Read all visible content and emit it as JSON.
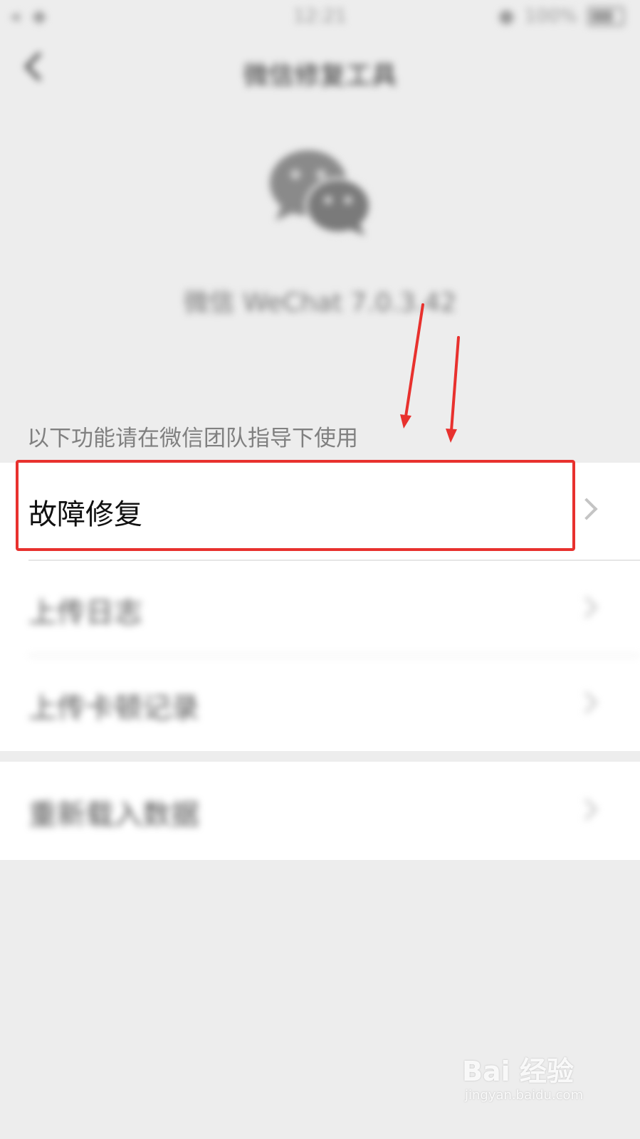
{
  "status_bar": {
    "time": "12:21",
    "battery": "100%"
  },
  "nav": {
    "title": "微信修复工具"
  },
  "app": {
    "version": "微信 WeChat 7.0.3.42"
  },
  "section_hint": "以下功能请在微信团队指导下使用",
  "list": {
    "items": [
      {
        "label": "故障修复"
      },
      {
        "label": "上传日志"
      },
      {
        "label": "上传卡顿记录"
      },
      {
        "label": "重新载入数据"
      }
    ]
  },
  "annotation": {
    "highlight_color": "#e8312e"
  },
  "watermark": {
    "brand": "Bai 经验",
    "site": "jingyan.baidu.com"
  }
}
